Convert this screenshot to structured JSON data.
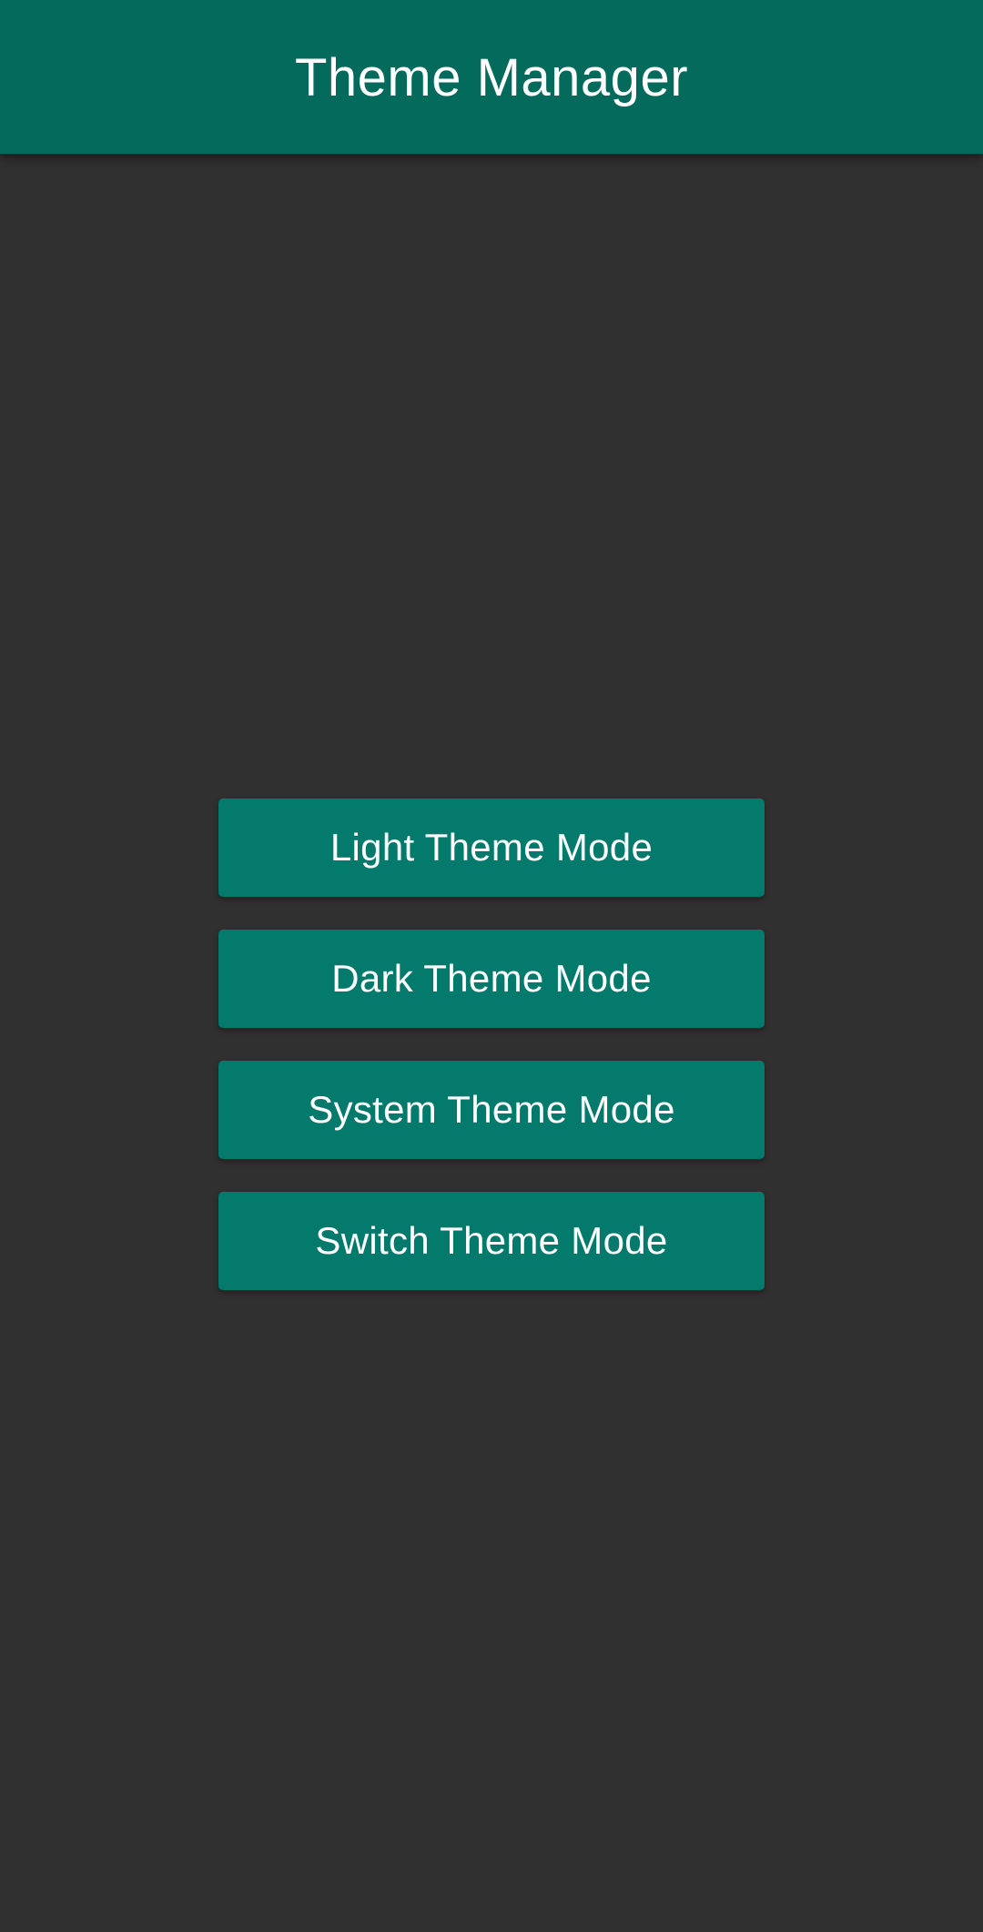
{
  "app_bar": {
    "title": "Theme Manager"
  },
  "buttons": [
    {
      "label": "Light Theme Mode"
    },
    {
      "label": "Dark Theme Mode"
    },
    {
      "label": "System Theme Mode"
    },
    {
      "label": "Switch Theme Mode"
    }
  ],
  "colors": {
    "app_bar_background": "#046a5c",
    "page_background": "#303030",
    "button_background": "#047a6c",
    "text": "#ffffff"
  }
}
